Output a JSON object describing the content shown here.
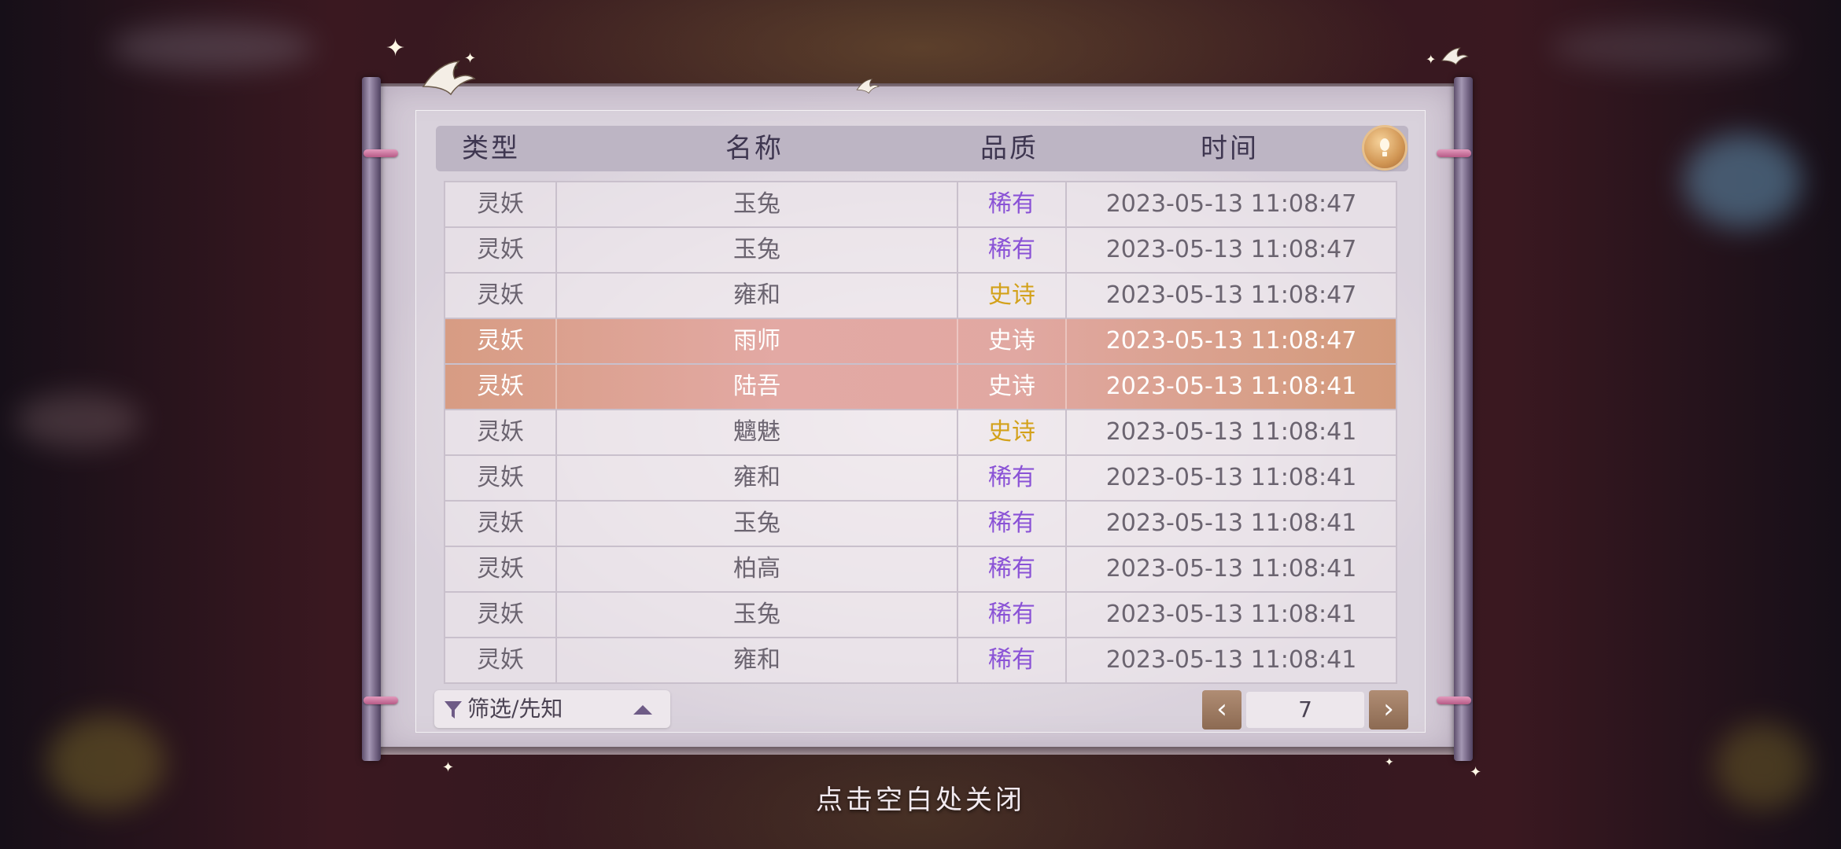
{
  "header": {
    "col_type": "类型",
    "col_name": "名称",
    "col_quality": "品质",
    "col_time": "时间"
  },
  "rows": [
    {
      "type": "灵妖",
      "name": "玉兔",
      "quality": "稀有",
      "time": "2023-05-13  11:08:47"
    },
    {
      "type": "灵妖",
      "name": "玉兔",
      "quality": "稀有",
      "time": "2023-05-13  11:08:47"
    },
    {
      "type": "灵妖",
      "name": "雍和",
      "quality": "史诗",
      "time": "2023-05-13  11:08:47"
    },
    {
      "type": "灵妖",
      "name": "雨师",
      "quality": "史诗",
      "time": "2023-05-13  11:08:47"
    },
    {
      "type": "灵妖",
      "name": "陆吾",
      "quality": "史诗",
      "time": "2023-05-13  11:08:41"
    },
    {
      "type": "灵妖",
      "name": "魑魅",
      "quality": "史诗",
      "time": "2023-05-13  11:08:41"
    },
    {
      "type": "灵妖",
      "name": "雍和",
      "quality": "稀有",
      "time": "2023-05-13  11:08:41"
    },
    {
      "type": "灵妖",
      "name": "玉兔",
      "quality": "稀有",
      "time": "2023-05-13  11:08:41"
    },
    {
      "type": "灵妖",
      "name": "柏高",
      "quality": "稀有",
      "time": "2023-05-13  11:08:41"
    },
    {
      "type": "灵妖",
      "name": "玉兔",
      "quality": "稀有",
      "time": "2023-05-13  11:08:41"
    },
    {
      "type": "灵妖",
      "name": "雍和",
      "quality": "稀有",
      "time": "2023-05-13  11:08:41"
    }
  ],
  "highlighted_rows": [
    3,
    4
  ],
  "filter": {
    "label": "筛选/先知"
  },
  "pagination": {
    "prev": "‹",
    "next": "›",
    "page": "7"
  },
  "close_hint": "点击空白处关闭",
  "icons": {
    "hint": "lightbulb-icon",
    "filter": "funnel-icon",
    "expand": "triangle-up-icon"
  },
  "colors": {
    "rare": "#8a52d6",
    "epic": "#d3a11a",
    "highlight": "#e1a8a2",
    "header_bg": "#bdb5c4"
  }
}
